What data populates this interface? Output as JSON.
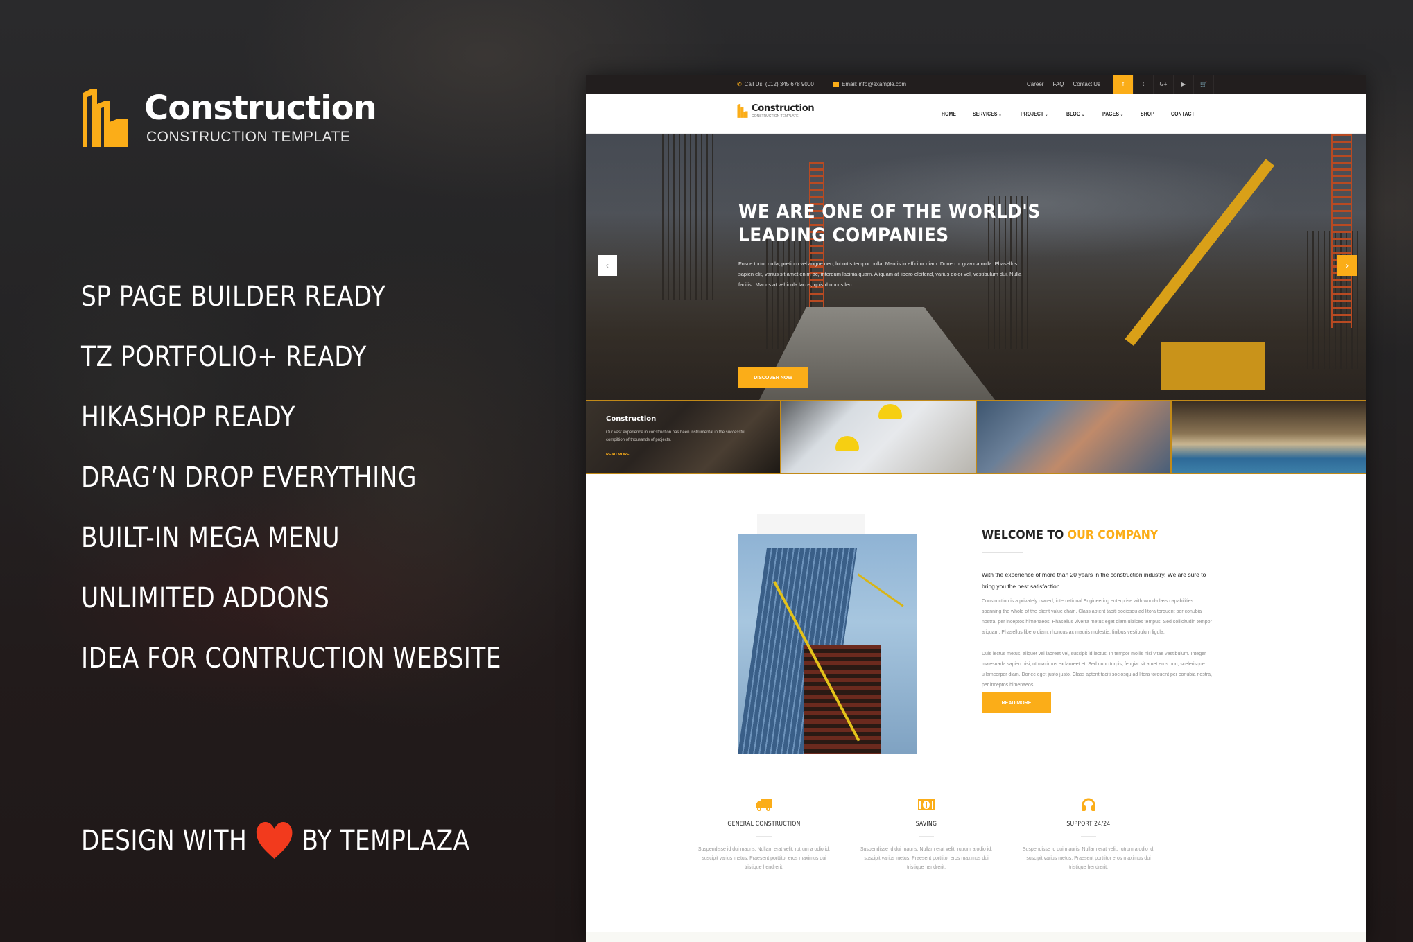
{
  "brand": {
    "name": "Construction",
    "tagline": "CONSTRUCTION TEMPLATE",
    "accent_color": "#fbad18"
  },
  "features": [
    "SP PAGE BUILDER READY",
    "TZ PORTFOLIO+ READY",
    "HIKASHOP READY",
    "DRAG’N DROP EVERYTHING",
    "BUILT-IN MEGA MENU",
    "UNLIMITED ADDONS",
    "IDEA FOR CONTRUCTION WEBSITE"
  ],
  "credit": {
    "before": "DESIGN WITH",
    "icon": "heart-icon",
    "after": "BY TEMPLAZA",
    "heart_color": "#f23a1d"
  },
  "mockup": {
    "topbar": {
      "phone": "Call Us: (012) 345 678 9000",
      "email": "Email: info@example.com",
      "links": [
        "Career",
        "FAQ",
        "Contact Us"
      ],
      "social": [
        {
          "icon": "facebook-icon",
          "glyph": "f"
        },
        {
          "icon": "twitter-icon",
          "glyph": "t"
        },
        {
          "icon": "google-plus-icon",
          "glyph": "G+"
        },
        {
          "icon": "youtube-icon",
          "glyph": "▶"
        },
        {
          "icon": "cart-icon",
          "glyph": "🛒"
        }
      ]
    },
    "nav": {
      "logo_name": "Construction",
      "logo_sub": "CONSTRUCTION TEMPLATE",
      "items": [
        {
          "label": "HOME",
          "dropdown": false
        },
        {
          "label": "SERVICES",
          "dropdown": true
        },
        {
          "label": "PROJECT",
          "dropdown": true
        },
        {
          "label": "BLOG",
          "dropdown": true
        },
        {
          "label": "PAGES",
          "dropdown": true
        },
        {
          "label": "SHOP",
          "dropdown": false
        },
        {
          "label": "CONTACT",
          "dropdown": false
        }
      ],
      "caret": "⌄"
    },
    "hero": {
      "title_line1": "WE ARE ONE OF THE WORLD'S",
      "title_line2": "LEADING COMPANIES",
      "text": "Fusce tortor nulla, pretium vel augue nec, lobortis tempor nulla. Mauris in efficitur diam. Donec ut gravida nulla. Phasellus sapien elit, varius sit amet enim ac, interdum lacinia quam. Aliquam at libero eleifend, varius dolor vel, vestibulum dui. Nulla facilisi. Mauris at vehicula lacus, quis rhoncus leo",
      "button": "DISCOVER NOW",
      "prev_glyph": "‹",
      "next_glyph": "›"
    },
    "thumbs": [
      {
        "title": "Construction",
        "text": "Our vast experience in construction has been instrumental in the successful compiltion of thousands of projects.",
        "link": "READ MORE..."
      }
    ],
    "welcome": {
      "title_plain": "WELCOME TO",
      "title_accent": "OUR COMPANY",
      "lead": "With the experience of more than 20 years in the construction industry, We are sure to bring you the best satisfaction.",
      "p1": "Construction is a privately owned, international Engineering enterprise with world-class capabilities spanning the whole of the client value chain. Class aptent taciti sociosqu ad litora torquent per conubia nostra, per inceptos himenaeos. Phasellus viverra metus eget diam ultrices tempus. Sed sollicitudin tempor aliquam. Phasellus libero diam, rhoncus ac mauris molestie, finibus vestibulum ligula.",
      "p2": "Duis lectus metus, aliquet vel laoreet vel, suscipit id lectus. In tempor mollis nisl vitae vestibulum. Integer malesuada sapien nisi, ut maximus ex laoreet et. Sed nunc turpis, feugiat sit amet eros non, scelerisque ullamcorper diam. Donec eget justo justo. Class aptent taciti sociosqu ad litora torquent per conubia nostra, per inceptos himenaeos.",
      "button": "READ MORE"
    },
    "services": [
      {
        "icon": "truck-icon",
        "title": "GENERAL CONSTRUCTION",
        "text": "Suspendisse id dui mauris. Nullam erat velit, rutrum a odio id, suscipit varius metus. Praesent porttitor eros maximus dui tristique hendrerit."
      },
      {
        "icon": "money-icon",
        "title": "SAVING",
        "text": "Suspendisse id dui mauris. Nullam erat velit, rutrum a odio id, suscipit varius metus. Praesent porttitor eros maximus dui tristique hendrerit."
      },
      {
        "icon": "headphones-icon",
        "title": "SUPPORT 24/24",
        "text": "Suspendisse id dui mauris. Nullam erat velit, rutrum a odio id, suscipit varius metus. Praesent porttitor eros maximus dui tristique hendrerit."
      }
    ]
  }
}
